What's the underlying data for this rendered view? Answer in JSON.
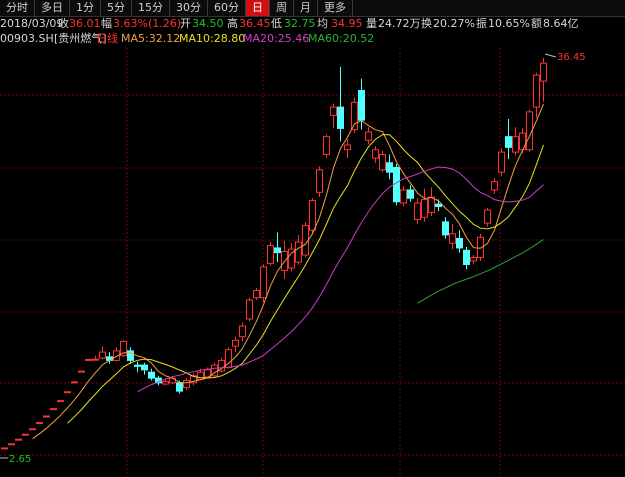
{
  "tabs": [
    {
      "label": "分时",
      "active": false
    },
    {
      "label": "多日",
      "active": false
    },
    {
      "label": "1分",
      "active": false
    },
    {
      "label": "5分",
      "active": false
    },
    {
      "label": "15分",
      "active": false
    },
    {
      "label": "30分",
      "active": false
    },
    {
      "label": "60分",
      "active": false
    },
    {
      "label": "日",
      "active": true
    },
    {
      "label": "周",
      "active": false
    },
    {
      "label": "月",
      "active": false
    },
    {
      "label": "更多",
      "active": false
    }
  ],
  "quote": {
    "date": "2018/03/09",
    "close_label": "收",
    "close": "36.01",
    "change_label": "幅",
    "change": "3.63%(1.26)",
    "open_label": "开",
    "open": "34.50",
    "high_label": "高",
    "high": "36.45",
    "low_label": "低",
    "low": "32.75",
    "avg_label": "均",
    "avg": "34.95",
    "volume_label": "量",
    "volume": "24.72万",
    "turnover_label": "换",
    "turnover": "20.27%",
    "amplitude_label": "振",
    "amplitude": "10.65%",
    "amount_label": "额",
    "amount": "8.64亿"
  },
  "legend": {
    "code": "00903.SH",
    "name": "[贵州燃气]",
    "period": "日线",
    "ma5": "MA5:32.12",
    "ma10": "MA10:28.80",
    "ma20": "MA20:25.46",
    "ma60": "MA60:20.52"
  },
  "colors": {
    "up": "#ff3232",
    "down": "#54ffff",
    "ma5": "#f0a040",
    "ma10": "#e8e020",
    "ma20": "#c83cc8",
    "ma60": "#2ea02e",
    "grid": "#6a0a0a"
  },
  "chart_data": {
    "type": "candlestick",
    "ylim": [
      2.65,
      36.45
    ],
    "max_label": "36.45",
    "min_label": "2.65",
    "ma_periods": [
      5,
      10,
      20,
      60
    ],
    "ohlc": [
      [
        3.5,
        3.5,
        3.5,
        3.5
      ],
      [
        3.85,
        3.85,
        3.85,
        3.85
      ],
      [
        4.24,
        4.24,
        4.24,
        4.24
      ],
      [
        4.66,
        4.66,
        4.66,
        4.66
      ],
      [
        5.12,
        5.12,
        5.12,
        5.12
      ],
      [
        5.64,
        5.64,
        5.64,
        5.64
      ],
      [
        6.2,
        6.2,
        6.2,
        6.2
      ],
      [
        6.82,
        6.82,
        6.82,
        6.82
      ],
      [
        7.5,
        7.5,
        7.5,
        7.5
      ],
      [
        8.25,
        8.25,
        8.25,
        8.25
      ],
      [
        9.08,
        9.08,
        9.08,
        9.08
      ],
      [
        9.99,
        9.99,
        9.99,
        9.99
      ],
      [
        10.98,
        10.98,
        10.98,
        10.98
      ],
      [
        11.0,
        11.3,
        11.0,
        11.0
      ],
      [
        11.1,
        12.1,
        11.0,
        11.6
      ],
      [
        11.2,
        11.6,
        10.6,
        10.9
      ],
      [
        10.9,
        12.0,
        10.8,
        11.7
      ],
      [
        11.3,
        12.6,
        11.2,
        12.5
      ],
      [
        11.7,
        12.0,
        10.6,
        10.9
      ],
      [
        10.5,
        10.8,
        9.9,
        10.4
      ],
      [
        10.5,
        10.7,
        9.7,
        10.1
      ],
      [
        9.9,
        10.2,
        9.2,
        9.4
      ],
      [
        9.4,
        9.6,
        8.8,
        9.0
      ],
      [
        8.9,
        9.3,
        8.8,
        9.1
      ],
      [
        9.0,
        9.6,
        8.9,
        9.4
      ],
      [
        9.0,
        9.2,
        8.1,
        8.3
      ],
      [
        8.6,
        9.4,
        8.4,
        9.2
      ],
      [
        9.0,
        9.8,
        8.8,
        9.6
      ],
      [
        9.3,
        10.2,
        9.2,
        9.9
      ],
      [
        9.5,
        10.3,
        9.4,
        10.1
      ],
      [
        9.6,
        10.7,
        9.5,
        10.5
      ],
      [
        10.0,
        11.1,
        9.9,
        10.9
      ],
      [
        10.3,
        12.0,
        10.2,
        11.8
      ],
      [
        12.1,
        12.9,
        11.6,
        12.6
      ],
      [
        12.9,
        14.1,
        12.5,
        13.8
      ],
      [
        14.4,
        16.2,
        14.2,
        16.0
      ],
      [
        16.2,
        17.0,
        16.0,
        16.8
      ],
      [
        16.2,
        19.0,
        15.8,
        18.8
      ],
      [
        19.1,
        20.9,
        18.9,
        20.6
      ],
      [
        20.4,
        21.7,
        19.2,
        20.0
      ],
      [
        18.5,
        21.0,
        17.8,
        20.1
      ],
      [
        18.7,
        20.8,
        18.4,
        20.3
      ],
      [
        19.2,
        21.5,
        19.0,
        20.9
      ],
      [
        19.8,
        22.6,
        19.6,
        22.3
      ],
      [
        21.9,
        24.6,
        21.7,
        24.4
      ],
      [
        25.1,
        27.3,
        24.7,
        27.0
      ],
      [
        28.3,
        30.0,
        28.0,
        29.8
      ],
      [
        31.6,
        32.6,
        30.5,
        32.3
      ],
      [
        32.3,
        35.7,
        29.4,
        30.5
      ],
      [
        28.7,
        29.6,
        28.0,
        29.1
      ],
      [
        30.4,
        33.1,
        30.1,
        32.7
      ],
      [
        33.7,
        34.7,
        30.4,
        31.2
      ],
      [
        29.5,
        30.6,
        29.2,
        30.2
      ],
      [
        28.0,
        29.0,
        27.6,
        28.7
      ],
      [
        27.0,
        28.6,
        26.8,
        28.3
      ],
      [
        27.6,
        28.3,
        26.2,
        26.8
      ],
      [
        27.2,
        27.5,
        24.0,
        24.3
      ],
      [
        24.2,
        25.6,
        23.9,
        25.3
      ],
      [
        25.3,
        25.7,
        24.3,
        24.6
      ],
      [
        22.8,
        24.6,
        22.4,
        24.2
      ],
      [
        23.0,
        25.4,
        22.6,
        24.5
      ],
      [
        23.4,
        25.5,
        23.1,
        24.7
      ],
      [
        24.1,
        24.5,
        23.5,
        23.9
      ],
      [
        22.6,
        23.0,
        21.2,
        21.5
      ],
      [
        20.8,
        22.4,
        20.3,
        21.6
      ],
      [
        21.2,
        21.9,
        20.0,
        20.4
      ],
      [
        20.2,
        20.5,
        18.6,
        19.0
      ],
      [
        19.3,
        19.8,
        19.0,
        19.6
      ],
      [
        19.6,
        21.6,
        19.3,
        21.3
      ],
      [
        22.5,
        23.8,
        22.2,
        23.6
      ],
      [
        25.3,
        26.3,
        25.0,
        26.0
      ],
      [
        26.8,
        28.8,
        26.5,
        28.5
      ],
      [
        29.8,
        31.3,
        27.9,
        28.9
      ],
      [
        28.5,
        30.6,
        28.2,
        29.8
      ],
      [
        28.7,
        30.5,
        28.4,
        30.1
      ],
      [
        28.7,
        32.1,
        28.5,
        31.9
      ],
      [
        32.3,
        35.2,
        31.4,
        35.0
      ],
      [
        34.5,
        36.45,
        32.75,
        36.01
      ]
    ]
  }
}
